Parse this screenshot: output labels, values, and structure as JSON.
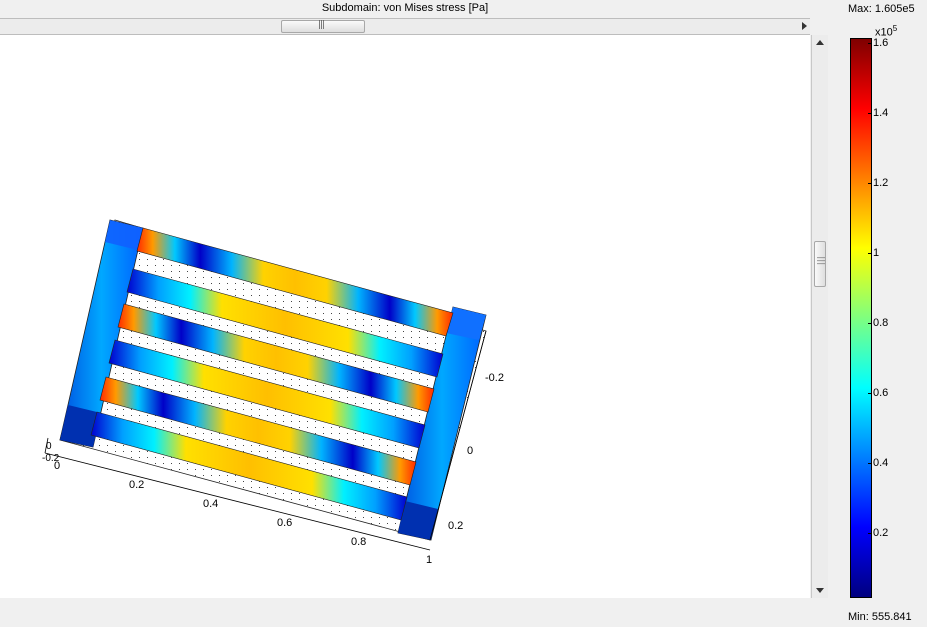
{
  "plot": {
    "title": "Subdomain: von Mises stress [Pa]",
    "max_label": "Max: 1.605e5",
    "min_label": "Min: 555.841",
    "scale_base": "x10",
    "scale_exponent": "5"
  },
  "colorbar": {
    "ticks": [
      "1.6",
      "1.4",
      "1.2",
      "1",
      "0.8",
      "0.6",
      "0.4",
      "0.2"
    ],
    "tick_values": [
      1.6,
      1.4,
      1.2,
      1.0,
      0.8,
      0.6,
      0.4,
      0.2
    ],
    "range": [
      0.00555841,
      1.605
    ],
    "colormap": "jet"
  },
  "axes": {
    "x_ticks": [
      "0",
      "0.2",
      "0.4",
      "0.6",
      "0.8",
      "1"
    ],
    "y_ticks": [
      "-0.2",
      "0",
      "0.2"
    ],
    "z_ticks": [
      "0",
      "-0.2"
    ]
  },
  "colors": {
    "dark_blue": "#00007f",
    "blue": "#0000ff",
    "cyan": "#00ffff",
    "yellow": "#ffff00",
    "orange": "#ff7f00",
    "red": "#ff0000",
    "dark_red": "#7f0000"
  },
  "icons": {
    "scroll_right": "arrow-right-icon",
    "scroll_up": "arrow-up-icon",
    "scroll_down": "arrow-down-icon"
  }
}
